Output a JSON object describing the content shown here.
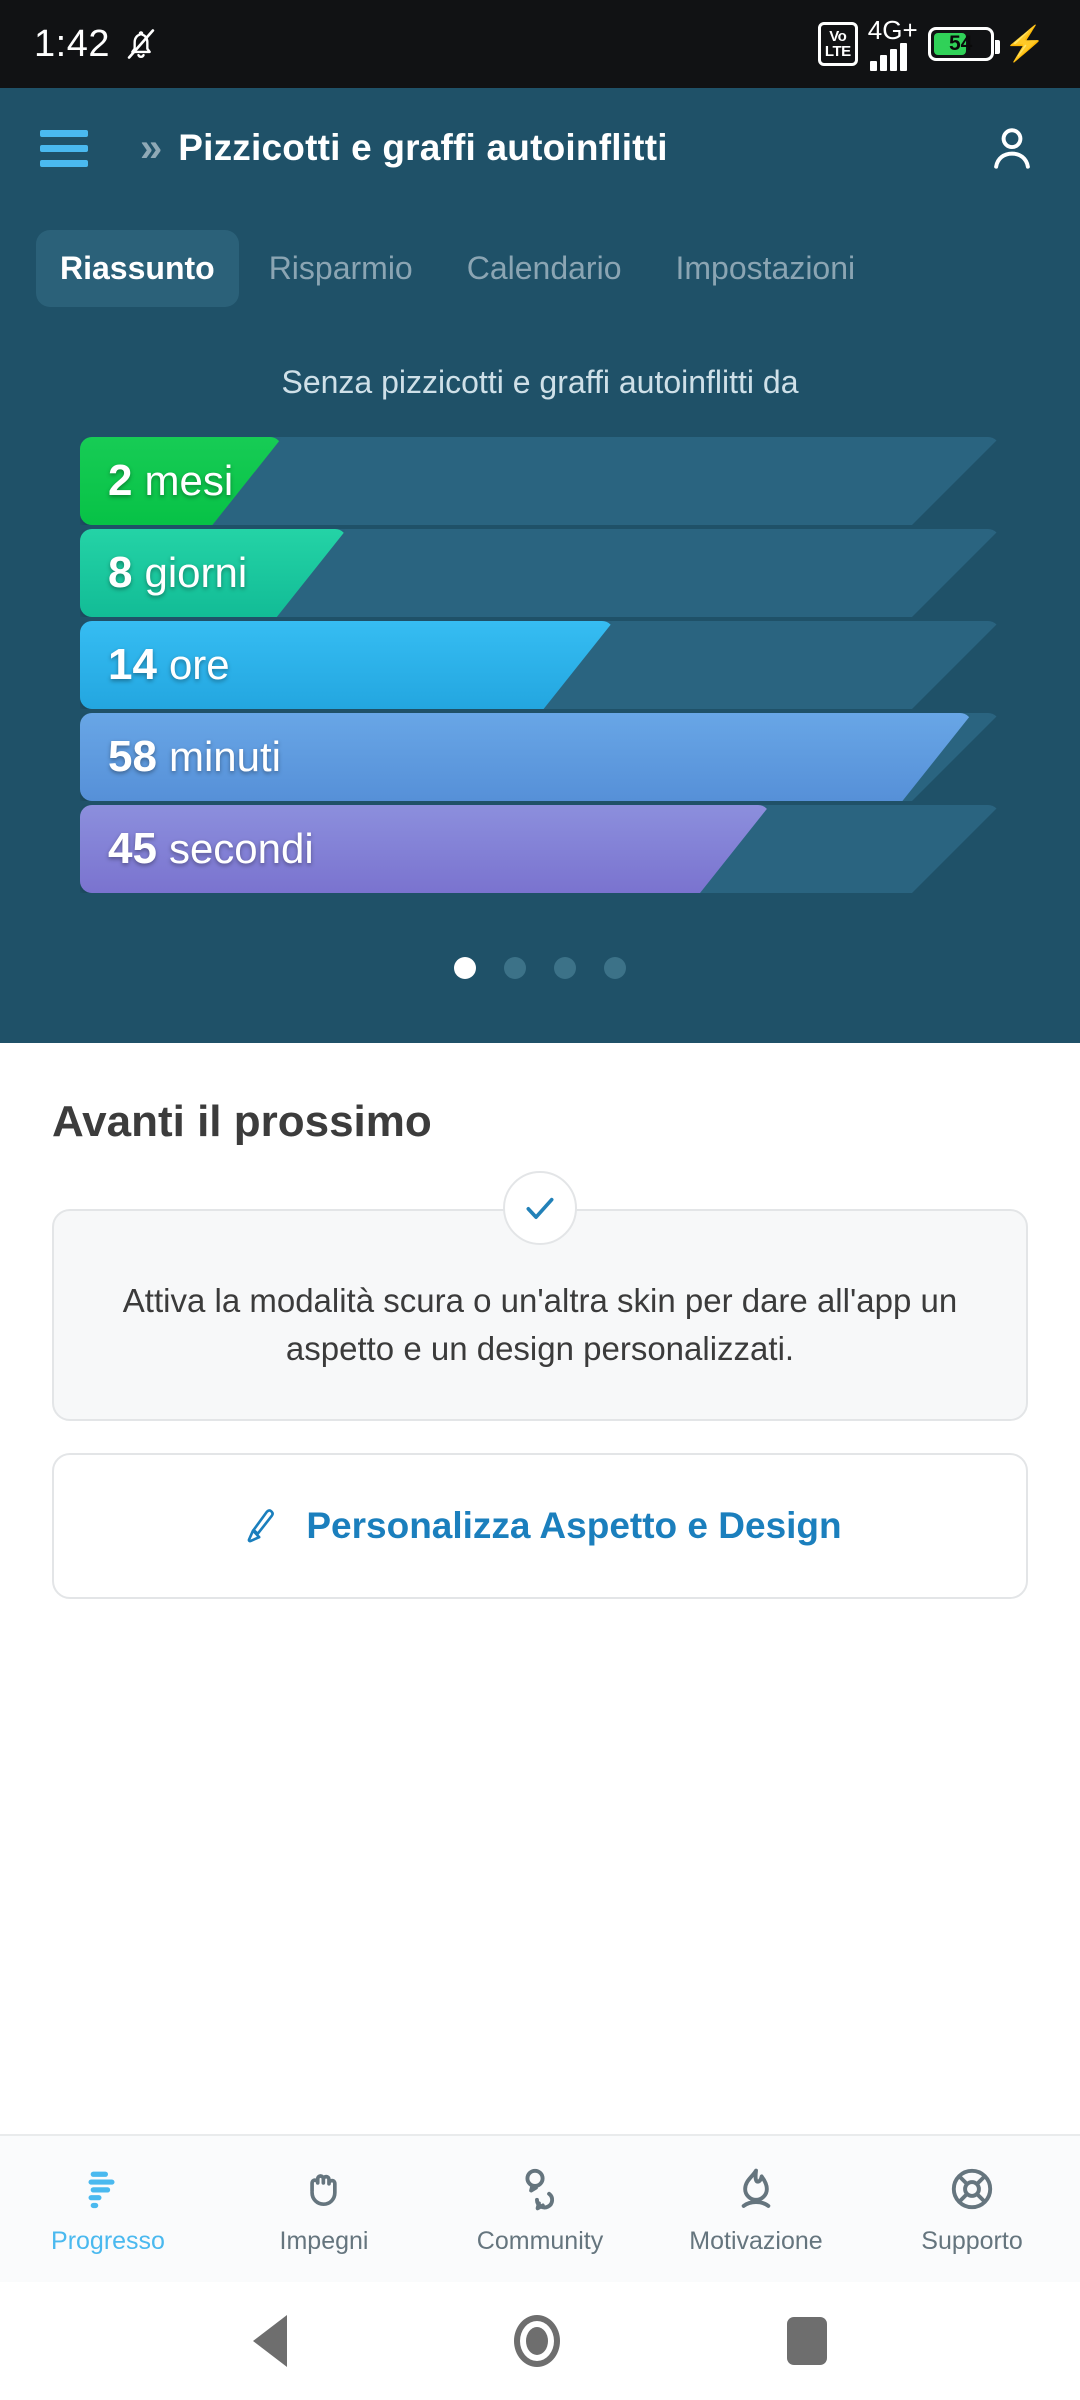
{
  "status_bar": {
    "time": "1:42",
    "mute_icon": "bell-muted-icon",
    "volte_top": "Vo",
    "volte_bottom": "LTE",
    "network": "4G+",
    "battery_percent": "54",
    "battery_color": "#30d158",
    "charging_icon": "lightning-bolt-icon"
  },
  "header": {
    "menu_icon": "hamburger-menu-icon",
    "chevron": "»",
    "title": "Pizzicotti e graffi autoinflitti",
    "account_icon": "person-account-icon",
    "accent_color": "#4ab9ef",
    "background_color": "#1f5168"
  },
  "tabs": [
    {
      "label": "Riassunto",
      "active": true
    },
    {
      "label": "Risparmio",
      "active": false
    },
    {
      "label": "Calendario",
      "active": false
    },
    {
      "label": "Impostazioni",
      "active": false
    }
  ],
  "summary": {
    "subtitle": "Senza pizzicotti e graffi autoinflitti da"
  },
  "chart_data": {
    "type": "bar",
    "title": "Senza pizzicotti e graffi autoinflitti da",
    "orientation": "horizontal",
    "track_color": "#2a6480",
    "categories": [
      "mesi",
      "giorni",
      "ore",
      "minuti",
      "secondi"
    ],
    "values": [
      2,
      8,
      14,
      58,
      45
    ],
    "maxima": [
      null,
      30,
      24,
      60,
      60
    ],
    "fill_percent": [
      22,
      29,
      58,
      97,
      75
    ],
    "labels": [
      "2 mesi",
      "8 giorni",
      "14 ore",
      "58 minuti",
      "45 secondi"
    ],
    "colors": [
      "#17cc55",
      "#20cba0",
      "#2fb5ea",
      "#5e9de0",
      "#8084d6"
    ],
    "colors_end": [
      "#07c246",
      "#15bf9c",
      "#25a9e2",
      "#5691d9",
      "#7a73cf"
    ],
    "xlabel": "",
    "ylabel": "",
    "grid": false,
    "legend": "none"
  },
  "bars": [
    {
      "value": "2",
      "unit": "mesi",
      "percent": 22,
      "color_start": "#17cc55",
      "color_end": "#07c246"
    },
    {
      "value": "8",
      "unit": "giorni",
      "percent": 29,
      "color_start": "#24d3a6",
      "color_end": "#12bc96"
    },
    {
      "value": "14",
      "unit": "ore",
      "percent": 58,
      "color_start": "#36bdf2",
      "color_end": "#23a6e0"
    },
    {
      "value": "58",
      "unit": "minuti",
      "percent": 97,
      "color_start": "#68a6e6",
      "color_end": "#5690d8"
    },
    {
      "value": "45",
      "unit": "secondi",
      "percent": 75,
      "color_start": "#8c8fdd",
      "color_end": "#7a73cf"
    }
  ],
  "pager": {
    "count": 4,
    "active_index": 0
  },
  "next_section": {
    "title": "Avanti il prossimo",
    "check_icon": "check-mark-icon",
    "check_color": "#2281b8",
    "card_text": "Attiva la modalità scura o un'altra skin per dare all'app un aspetto e un design personalizzati.",
    "cta_icon": "paintbrush-icon",
    "cta_label": "Personalizza Aspetto e Design",
    "cta_color": "#1b7fbd"
  },
  "bottom_nav": [
    {
      "label": "Progresso",
      "icon": "progress-bars-icon",
      "active": true
    },
    {
      "label": "Impegni",
      "icon": "hand-pledge-icon",
      "active": false
    },
    {
      "label": "Community",
      "icon": "speech-bubbles-icon",
      "active": false
    },
    {
      "label": "Motivazione",
      "icon": "flame-icon",
      "active": false
    },
    {
      "label": "Supporto",
      "icon": "lifebuoy-icon",
      "active": false
    }
  ],
  "android_nav": {
    "back": "back-triangle-icon",
    "home": "home-circle-icon",
    "recents": "recents-square-icon"
  }
}
